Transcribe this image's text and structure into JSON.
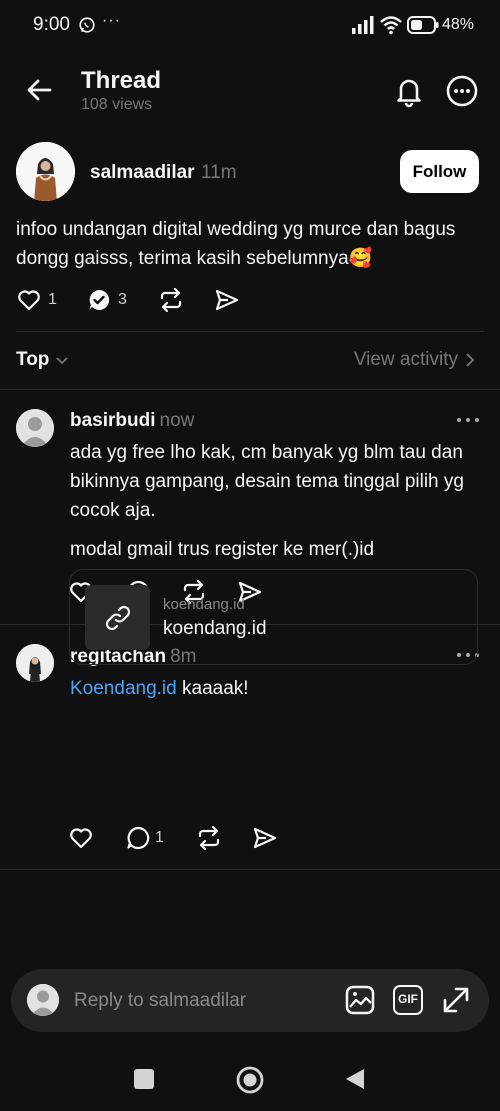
{
  "status_bar": {
    "time": "9:00",
    "dots": "···",
    "battery": "48%"
  },
  "header": {
    "title": "Thread",
    "views": "108 views"
  },
  "post": {
    "username": "salmaadilar",
    "time": "11m",
    "follow_label": "Follow",
    "text": "infoo undangan digital  wedding yg murce dan bagus dongg gaisss, terima kasih sebelumnya🥰",
    "likes": "1",
    "replies": "3"
  },
  "sort": {
    "label": "Top",
    "view_activity": "View activity"
  },
  "replies": [
    {
      "username": "basirbudi",
      "time": "now",
      "paragraphs": [
        "ada yg free lho kak, cm banyak yg blm tau dan bikinnya gampang, desain tema tinggal pilih yg cocok aja.",
        "modal gmail trus register ke mer(.)id"
      ]
    },
    {
      "username": "regitachan",
      "time": "8m",
      "link": "Koendang.id",
      "text_after_link": " kaaaak!",
      "reply_count": "1",
      "card": {
        "domain": "koendang.id",
        "title": "koendang.id"
      }
    }
  ],
  "composer": {
    "placeholder": "Reply to salmaadilar",
    "gif_label": "GIF"
  },
  "icons": {
    "back": "arrow-left-icon",
    "bell": "bell-icon",
    "more": "more-circle-icon",
    "like": "heart-icon",
    "reply": "comment-icon",
    "repost": "repost-icon",
    "share": "send-icon",
    "link": "link-icon"
  },
  "colors": {
    "background": "#101010",
    "link": "#4ea4f6",
    "muted": "#777777"
  }
}
